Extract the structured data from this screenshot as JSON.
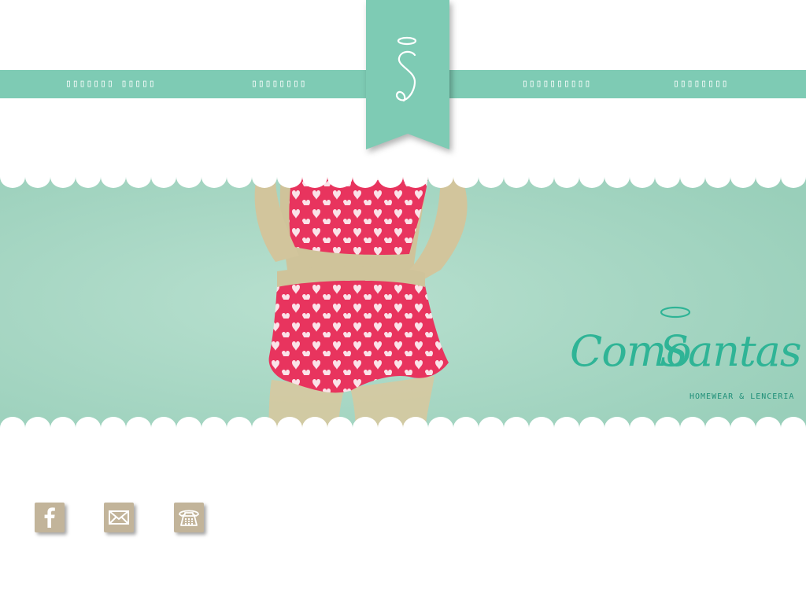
{
  "brand": {
    "ribbon_letter": "S",
    "logo_name": "Como Santas",
    "logo_word1": "Como",
    "logo_word2": "Santas",
    "tagline": "HOMEWEAR & LENCERIA"
  },
  "nav": {
    "items": [
      {
        "label": "▯▯▯▯▯▯▯ ▯▯▯▯▯"
      },
      {
        "label": "▯▯▯▯▯▯▯▯"
      },
      {
        "label": "▯▯▯▯▯▯▯▯▯▯"
      },
      {
        "label": "▯▯▯▯▯▯▯▯"
      }
    ]
  },
  "social": [
    {
      "icon": "facebook-icon"
    },
    {
      "icon": "mail-icon"
    },
    {
      "icon": "phone-icon"
    }
  ],
  "colors": {
    "mint": "#7ecbb4",
    "hero_bg": "#a6d7c3",
    "logo_teal": "#2fb496",
    "pajama_red": "#e8345e",
    "icon_tan": "#c2b49a"
  }
}
